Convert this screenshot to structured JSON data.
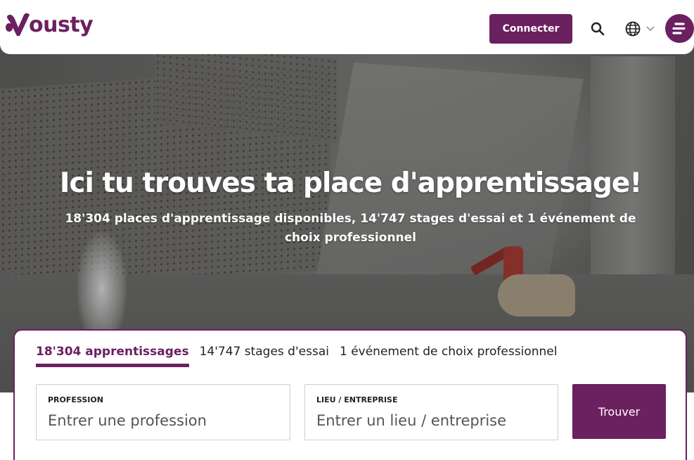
{
  "brand": {
    "name": "ousty",
    "color": "#6b2060"
  },
  "header": {
    "connect_label": "Connecter",
    "icons": {
      "search": "search-icon",
      "language": "globe-icon",
      "menu": "menu-icon"
    }
  },
  "hero": {
    "title": "Ici tu trouves ta place d'apprentissage!",
    "subtitle": "18'304 places d'apprentissage disponibles, 14'747 stages d'essai et 1 événement de choix professionnel"
  },
  "search": {
    "tabs": [
      {
        "label": "18'304 apprentissages",
        "active": true
      },
      {
        "label": "14'747 stages d'essai",
        "active": false
      },
      {
        "label": "1 événement de choix professionnel",
        "active": false
      }
    ],
    "profession": {
      "label": "PROFESSION",
      "placeholder": "Entrer une profession",
      "value": ""
    },
    "location": {
      "label": "LIEU / ENTREPRISE",
      "placeholder": "Entrer un lieu / entreprise",
      "value": ""
    },
    "submit_label": "Trouver"
  }
}
